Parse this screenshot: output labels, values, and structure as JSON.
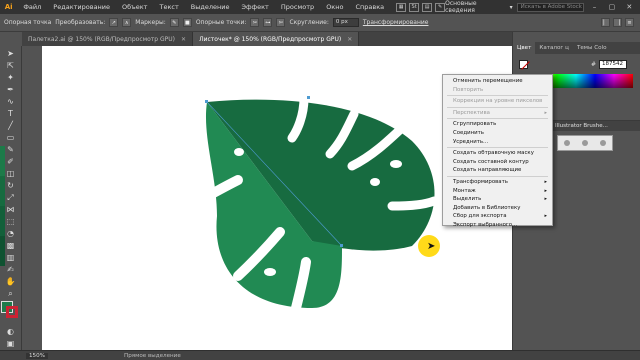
{
  "menubar": {
    "logo": "Ai",
    "items": [
      "Файл",
      "Редактирование",
      "Объект",
      "Текст",
      "Выделение",
      "Эффект",
      "Просмотр",
      "Окно",
      "Справка"
    ],
    "workspace": "Основные сведения",
    "stock_search": "Искать в Adobe Stock"
  },
  "controlbar": {
    "selection_label": "Опорная точка",
    "convert_label": "Преобразовать:",
    "handles_label": "Маркеры:",
    "anchors_label": "Опорные точки:",
    "round_label": "Скругление:",
    "round_value": "0 px",
    "transform_link": "Трансформирование"
  },
  "tabs": [
    {
      "label": "Палетка2.ai @ 150% (RGB/Предпросмотр GPU)",
      "active": false
    },
    {
      "label": "Листочек* @ 150% (RGB/Предпросмотр GPU)",
      "active": true
    }
  ],
  "context_menu": {
    "items": [
      {
        "label": "Отменить перемещение",
        "disabled": false
      },
      {
        "label": "Повторить",
        "disabled": true
      },
      {
        "sep": true
      },
      {
        "label": "Коррекция на уровне пикселов",
        "disabled": true
      },
      {
        "sep": true
      },
      {
        "label": "Перспектива",
        "disabled": true,
        "submenu": true
      },
      {
        "sep": true
      },
      {
        "label": "Сгруппировать",
        "disabled": false
      },
      {
        "label": "Соединить",
        "disabled": false
      },
      {
        "label": "Усреднить...",
        "disabled": false
      },
      {
        "sep": true
      },
      {
        "label": "Создать обтравочную маску",
        "disabled": false
      },
      {
        "label": "Создать составной контур",
        "disabled": false
      },
      {
        "label": "Создать направляющие",
        "disabled": false
      },
      {
        "sep": true
      },
      {
        "label": "Трансформировать",
        "disabled": false,
        "submenu": true
      },
      {
        "label": "Монтаж",
        "disabled": false,
        "submenu": true
      },
      {
        "label": "Выделить",
        "disabled": false,
        "submenu": true
      },
      {
        "label": "Добавить в Библиотеку",
        "disabled": false
      },
      {
        "label": "Сбор для экспорта",
        "disabled": false,
        "submenu": true
      },
      {
        "label": "Экспорт выбранного...",
        "disabled": false
      }
    ]
  },
  "panels": {
    "tabs": [
      "Цвет",
      "Каталог ц",
      "Темы Colo"
    ],
    "hex_label": "#",
    "hex_value": "187542",
    "brush_title": "Illustrator Brushe..."
  },
  "colors": {
    "leaf_light": "#218a53",
    "leaf_dark": "#176b40",
    "accent": "#f7a21b"
  },
  "statusbar": {
    "zoom": "150%",
    "status_text": "Прямое выделение"
  }
}
